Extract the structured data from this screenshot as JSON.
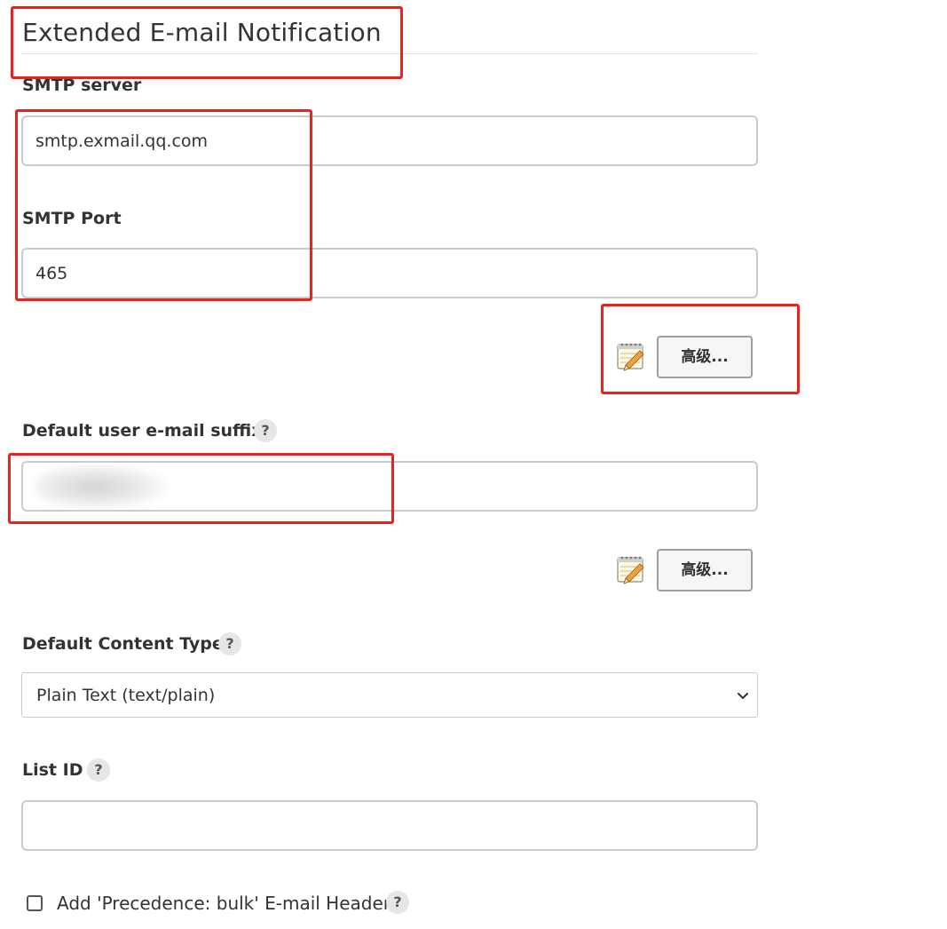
{
  "section": {
    "title": "Extended E-mail Notification"
  },
  "smtp_server": {
    "label": "SMTP server",
    "value": "smtp.exmail.qq.com"
  },
  "smtp_port": {
    "label": "SMTP Port",
    "value": "465"
  },
  "advanced_1": {
    "label": "高级...",
    "icon": "notepad-pencil-icon"
  },
  "default_suffix": {
    "label": "Default user e-mail suffix",
    "help": "?",
    "value": ""
  },
  "advanced_2": {
    "label": "高级...",
    "icon": "notepad-pencil-icon"
  },
  "content_type": {
    "label": "Default Content Type",
    "help": "?",
    "selected": "Plain Text (text/plain)"
  },
  "list_id": {
    "label": "List ID",
    "help": "?",
    "value": ""
  },
  "precedence": {
    "label": "Add 'Precedence: bulk' E-mail Header",
    "help": "?",
    "checked": false
  },
  "colors": {
    "annotation_red": "#e8231f",
    "input_border": "#c8ccd0"
  }
}
